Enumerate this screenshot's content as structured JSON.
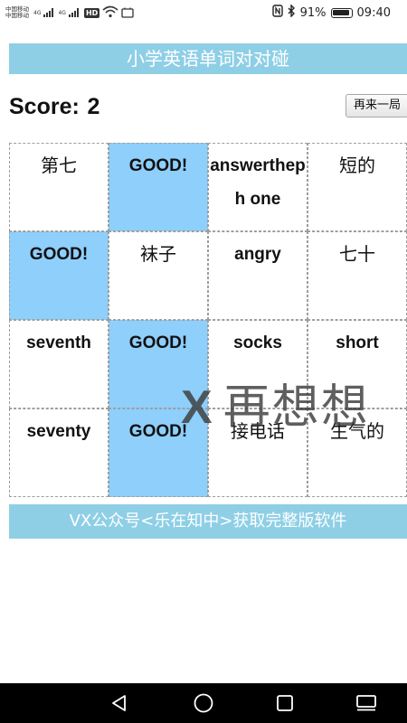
{
  "status_bar": {
    "carrier_1": "中国移动",
    "carrier_2": "中国移动",
    "network_1": "4G",
    "network_2": "4G",
    "hd_label": "HD",
    "battery_percent": "91%",
    "time": "09:40"
  },
  "header": {
    "title": "小学英语单词对对碰"
  },
  "score": {
    "label": "Score:",
    "value": "2"
  },
  "replay_button_label": "再来一局",
  "grid": {
    "cells": [
      {
        "text": "第七",
        "state": "cn"
      },
      {
        "text": "GOOD!",
        "state": "matched"
      },
      {
        "text": "answertheph one",
        "state": "word"
      },
      {
        "text": "短的",
        "state": "cn"
      },
      {
        "text": "GOOD!",
        "state": "matched"
      },
      {
        "text": "袜子",
        "state": "cn"
      },
      {
        "text": "angry",
        "state": "word"
      },
      {
        "text": "七十",
        "state": "cn"
      },
      {
        "text": "seventh",
        "state": "word"
      },
      {
        "text": "GOOD!",
        "state": "matched"
      },
      {
        "text": "socks",
        "state": "word"
      },
      {
        "text": "short",
        "state": "word"
      },
      {
        "text": "seventy",
        "state": "word"
      },
      {
        "text": "GOOD!",
        "state": "matched"
      },
      {
        "text": "接电话",
        "state": "cn"
      },
      {
        "text": "生气的",
        "state": "cn"
      }
    ]
  },
  "toast": {
    "mark": "X",
    "text": "再想想"
  },
  "footer": {
    "text": "VX公众号<乐在知中>获取完整版软件"
  },
  "colors": {
    "banner": "#8ecfe6",
    "matched_cell": "#8ecffb",
    "navbar": "#000000"
  },
  "nav_icons": [
    "back-icon",
    "home-icon",
    "recents-icon",
    "keyboard-icon"
  ]
}
